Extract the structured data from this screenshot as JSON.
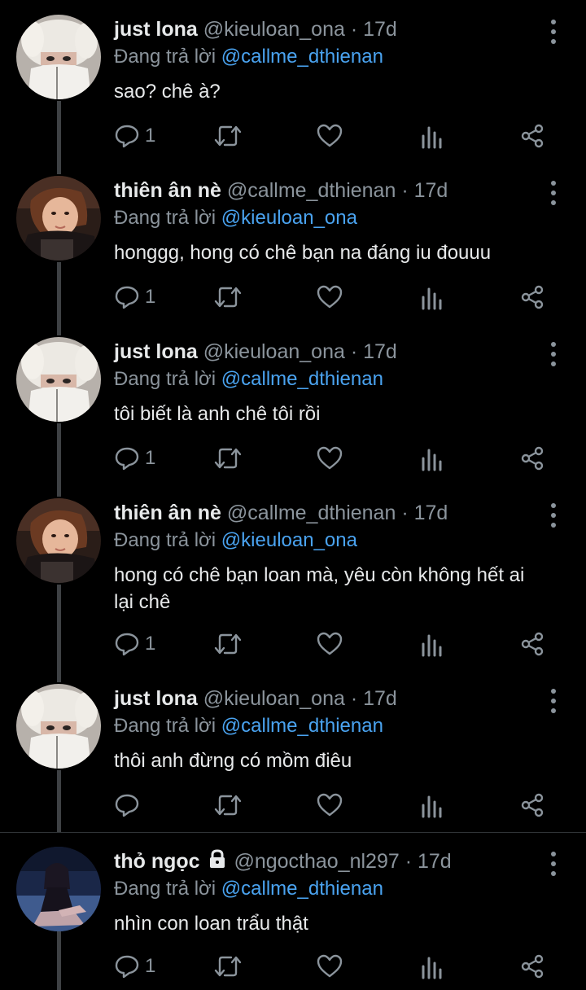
{
  "colors": {
    "background": "#000000",
    "text": "#e7e9ea",
    "muted": "#8b949c",
    "mention": "#4aa3f0",
    "thread_line": "#3e4144"
  },
  "tweets": [
    {
      "name": "just lona",
      "handle": "@kieuloan_ona",
      "separator": "·",
      "time": "17d",
      "replying_label": "Đang trả lời",
      "reply_to": "@callme_dthienan",
      "text": "sao? chê à?",
      "reply_count": "1",
      "avatar": "avatar-just-lona",
      "locked": false
    },
    {
      "name": "thiên ân nè",
      "handle": "@callme_dthienan",
      "separator": "·",
      "time": "17d",
      "replying_label": "Đang trả lời",
      "reply_to": "@kieuloan_ona",
      "text": "honggg, hong có chê bạn na đáng iu đouuu",
      "reply_count": "1",
      "avatar": "avatar-thien-an",
      "locked": false
    },
    {
      "name": "just lona",
      "handle": "@kieuloan_ona",
      "separator": "·",
      "time": "17d",
      "replying_label": "Đang trả lời",
      "reply_to": "@callme_dthienan",
      "text": "tôi biết là anh chê tôi rồi",
      "reply_count": "1",
      "avatar": "avatar-just-lona",
      "locked": false
    },
    {
      "name": "thiên ân nè",
      "handle": "@callme_dthienan",
      "separator": "·",
      "time": "17d",
      "replying_label": "Đang trả lời",
      "reply_to": "@kieuloan_ona",
      "text": "hong có chê bạn loan mà, yêu còn không hết ai lại chê",
      "reply_count": "1",
      "avatar": "avatar-thien-an",
      "locked": false
    },
    {
      "name": "just lona",
      "handle": "@kieuloan_ona",
      "separator": "·",
      "time": "17d",
      "replying_label": "Đang trả lời",
      "reply_to": "@callme_dthienan",
      "text": "thôi anh đừng có mồm điêu",
      "reply_count": "",
      "avatar": "avatar-just-lona",
      "locked": false
    },
    {
      "name": "thỏ ngọc",
      "handle": "@ngocthao_nl297",
      "separator": "·",
      "time": "17d",
      "replying_label": "Đang trả lời",
      "reply_to": "@callme_dthienan",
      "text": "nhìn con loan trẩu thật",
      "reply_count": "1",
      "avatar": "avatar-tho-ngoc",
      "locked": true
    }
  ],
  "icons": {
    "reply": "reply-icon",
    "retweet": "retweet-icon",
    "like": "heart-icon",
    "analytics": "analytics-icon",
    "share": "share-icon",
    "more": "more-options-icon",
    "lock": "lock-icon"
  }
}
